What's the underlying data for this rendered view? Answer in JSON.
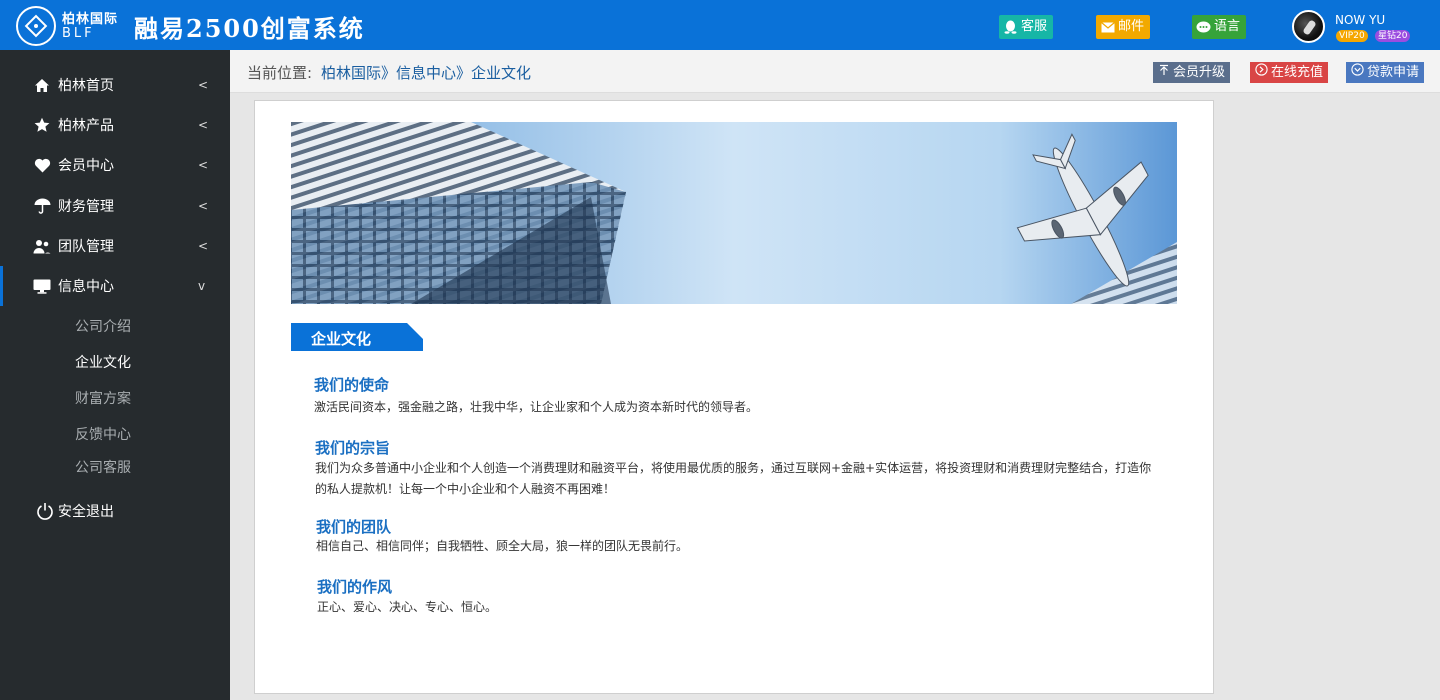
{
  "header": {
    "brand_cn": "柏林国际",
    "brand_en": "BLF",
    "app_title": "融易2500创富系统",
    "buttons": {
      "service": "客服",
      "mail": "邮件",
      "language": "语言"
    },
    "user": {
      "name": "NOW YU",
      "vip_badge": "VIP20",
      "star_badge": "星钻20"
    }
  },
  "sidebar": {
    "items": [
      {
        "label": "柏林首页",
        "icon": "home-icon",
        "arrow": "<"
      },
      {
        "label": "柏林产品",
        "icon": "star-icon",
        "arrow": "<"
      },
      {
        "label": "会员中心",
        "icon": "heart-icon",
        "arrow": "<"
      },
      {
        "label": "财务管理",
        "icon": "umbrella-icon",
        "arrow": "<"
      },
      {
        "label": "团队管理",
        "icon": "users-icon",
        "arrow": "<"
      },
      {
        "label": "信息中心",
        "icon": "monitor-icon",
        "arrow": "v"
      }
    ],
    "sub_items": [
      "公司介绍",
      "企业文化",
      "财富方案",
      "反馈中心",
      "公司客服"
    ],
    "logout": "安全退出"
  },
  "breadcrumb": {
    "label": "当前位置:",
    "path": "柏林国际》信息中心》企业文化"
  },
  "quick_actions": {
    "upgrade": "会员升级",
    "recharge": "在线充值",
    "loan": "贷款申请"
  },
  "content": {
    "section_title": "企业文化",
    "blocks": [
      {
        "title": "我们的使命",
        "text": "激活民间资本，强金融之路，壮我中华，让企业家和个人成为资本新时代的领导者。"
      },
      {
        "title": "我们的宗旨",
        "text": "我们为众多普通中小企业和个人创造一个消费理财和融资平台，将使用最优质的服务，通过互联网+金融+实体运营，将投资理财和消费理财完整结合，打造你的私人提款机！让每一个中小企业和个人融资不再困难！"
      },
      {
        "title": "我们的团队",
        "text": "相信自己、相信同伴；自我牺牲、顾全大局，狼一样的团队无畏前行。"
      },
      {
        "title": "我们的作风",
        "text": "正心、爱心、决心、专心、恒心。"
      }
    ]
  },
  "colors": {
    "header_blue": "#0a72d8",
    "sidebar_bg": "#262b2e",
    "link_blue": "#1a6fc2",
    "service_btn": "#16b6a6",
    "mail_btn": "#f2a900",
    "language_btn": "#36a33a",
    "upgrade_btn": "#5a6e8c",
    "recharge_btn": "#d94545",
    "loan_btn": "#4a78c0"
  }
}
